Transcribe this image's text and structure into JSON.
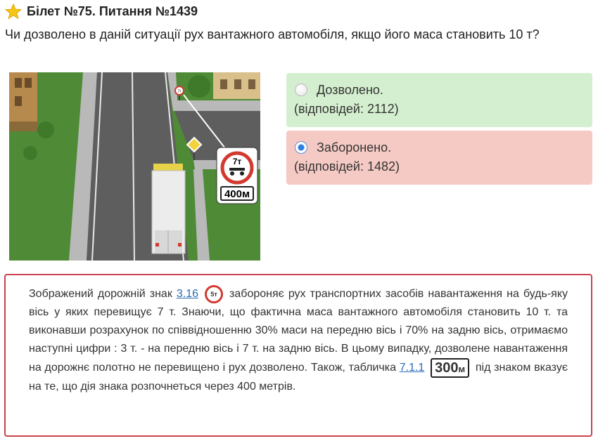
{
  "header": {
    "title": "Білет №75. Питання №1439",
    "question": "Чи дозволено в даній ситуації рух вантажного автомобіля, якщо його маса становить 10 т?"
  },
  "image": {
    "sign_weight": "7т",
    "sign_plate": "400м",
    "small_sign": "7т"
  },
  "answers": [
    {
      "label": "Дозволено.",
      "count": "(відповідей: 2112)",
      "selected": false,
      "status": "correct"
    },
    {
      "label": "Заборонено.",
      "count": "(відповідей: 1482)",
      "selected": true,
      "status": "wrong"
    }
  ],
  "explanation": {
    "p1": "Зображений дорожній знак ",
    "link1": "3.16",
    "sign_icon_text": "5т",
    "p2": " забороняє рух транспортних засобів навантаження на будь-яку вісь у яких перевищує 7 т. Знаючи, що фактична маса вантажного автомобіля становить 10 т. та виконавши розрахунок по співвідношенню 30% маси на передню вісь і 70% на задню вісь, отримаємо наступні цифри : 3 т. - на передню вісь і 7 т. на задню вісь. В цьому випадку, дозволене навантаження на дорожнє полотно не перевищено і рух дозволено. Також, табличка ",
    "link2": "7.1.1",
    "plate_number": "300",
    "plate_unit": "м",
    "p3": " під знаком вказує на те, що дія знака розпочнеться через 400 метрів."
  },
  "colors": {
    "correct_bg": "#d4efcf",
    "wrong_bg": "#f6cac4",
    "border": "#c9434b",
    "link": "#2a6ab8",
    "star": "#f5c518"
  }
}
